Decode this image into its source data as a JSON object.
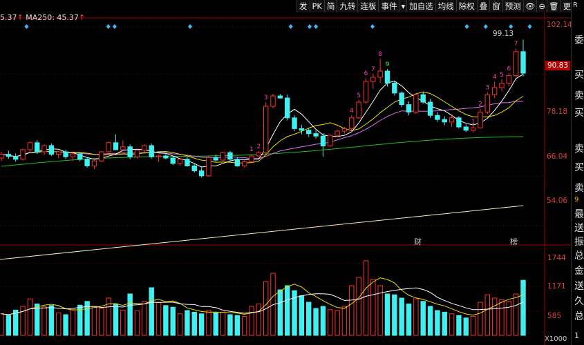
{
  "legend": {
    "ma_prefix": "5.37",
    "ma250_label": "MA250: 45.37",
    "arrow": "↑"
  },
  "toolbar": [
    {
      "label": "发",
      "name": "tool-fa"
    },
    {
      "label": "PK",
      "name": "tool-pk"
    },
    {
      "label": "简",
      "name": "tool-jian"
    },
    {
      "label": "九转",
      "name": "tool-jiuzhuan"
    },
    {
      "label": "连板",
      "name": "tool-lianban"
    },
    {
      "label": "事件",
      "name": "tool-shijian"
    },
    {
      "label": "▾",
      "name": "tool-dropdown-icon"
    },
    {
      "label": "加自选",
      "name": "tool-add-watchlist"
    },
    {
      "label": "均线",
      "name": "tool-junxian"
    },
    {
      "label": "除权",
      "name": "tool-chuquan"
    },
    {
      "label": "叠",
      "name": "tool-overlay"
    },
    {
      "label": "窗",
      "name": "tool-window"
    },
    {
      "label": "预测",
      "name": "tool-forecast"
    },
    {
      "label": "👁",
      "name": "tool-eye-icon"
    },
    {
      "label": "⊖",
      "name": "tool-zoom-out-icon"
    },
    {
      "label": "🗑",
      "name": "tool-trash-icon"
    },
    {
      "label": "更多",
      "name": "tool-more"
    },
    {
      "label": "⊕",
      "name": "tool-zoom-in-icon"
    },
    {
      "label": "▸",
      "name": "tool-next-icon"
    }
  ],
  "price_axis": [
    "102.14",
    "90.83",
    "78.18",
    "66.04",
    "54.06"
  ],
  "current_price": "90.83",
  "volume_axis": [
    "1744",
    "1171",
    "585"
  ],
  "volume_unit": "X1000",
  "high_label": "99.13",
  "events": {
    "cai": "财",
    "bang": "榜"
  },
  "right_panel": {
    "top": "R",
    "chars": [
      "委",
      "买",
      "卖",
      "买",
      "卖",
      "买",
      "卖"
    ],
    "mid": "9",
    "notes": [
      "最",
      "送",
      "振",
      "总",
      "金",
      "送",
      "久",
      "总"
    ],
    "bottom": "1"
  },
  "colors": {
    "up": "#ff3030",
    "down": "#40f0f0",
    "ma5": "#ffffff",
    "ma10": "#f0e000",
    "ma20": "#e070f0",
    "ma60": "#20c020",
    "ma250": "#f0f0c0",
    "nine_up": "#ff40c0",
    "nine_down": "#40ff40",
    "grid": "#a00000"
  },
  "chart_data": {
    "type": "candlestick",
    "ylim": [
      50,
      104
    ],
    "vol_ylim": [
      0,
      2000
    ],
    "candles": [
      [
        70.5,
        72.0,
        69.8,
        71.4,
        520
      ],
      [
        71.4,
        72.3,
        70.3,
        70.9,
        480
      ],
      [
        70.9,
        71.6,
        69.6,
        70.2,
        610
      ],
      [
        70.2,
        72.8,
        69.9,
        72.5,
        700
      ],
      [
        72.5,
        74.5,
        72.0,
        74.2,
        880
      ],
      [
        74.2,
        74.8,
        71.5,
        72.0,
        760
      ],
      [
        72.0,
        73.8,
        71.2,
        73.5,
        690
      ],
      [
        73.5,
        74.0,
        71.0,
        71.4,
        720
      ],
      [
        71.4,
        72.2,
        70.4,
        72.0,
        540
      ],
      [
        72.0,
        72.5,
        70.2,
        70.8,
        500
      ],
      [
        70.8,
        71.8,
        69.8,
        71.5,
        620
      ],
      [
        71.5,
        71.9,
        69.7,
        70.2,
        730
      ],
      [
        70.2,
        70.6,
        68.2,
        68.6,
        820
      ],
      [
        68.6,
        70.0,
        67.8,
        69.8,
        700
      ],
      [
        69.8,
        72.2,
        69.5,
        72.0,
        650
      ],
      [
        72.0,
        74.5,
        71.8,
        74.2,
        900
      ],
      [
        74.2,
        76.2,
        73.8,
        72.5,
        760
      ],
      [
        72.5,
        74.8,
        72.2,
        73.2,
        610
      ],
      [
        73.2,
        73.8,
        70.2,
        70.8,
        1000
      ],
      [
        70.8,
        72.6,
        70.4,
        72.4,
        590
      ],
      [
        72.4,
        73.8,
        71.9,
        73.5,
        820
      ],
      [
        73.5,
        74.0,
        70.4,
        70.8,
        1150
      ],
      [
        70.8,
        71.3,
        69.6,
        71.0,
        790
      ],
      [
        71.0,
        71.8,
        70.2,
        70.5,
        720
      ],
      [
        70.5,
        70.9,
        68.8,
        69.2,
        680
      ],
      [
        69.2,
        70.5,
        68.6,
        70.2,
        520
      ],
      [
        70.2,
        70.8,
        68.4,
        68.6,
        600
      ],
      [
        68.6,
        69.2,
        67.0,
        67.4,
        560
      ],
      [
        67.4,
        68.5,
        65.8,
        66.2,
        520
      ],
      [
        66.2,
        71.0,
        66.0,
        70.6,
        600
      ],
      [
        70.6,
        71.4,
        69.6,
        70.0,
        540
      ],
      [
        70.0,
        72.0,
        69.8,
        71.8,
        560
      ],
      [
        71.8,
        72.2,
        69.6,
        70.2,
        500
      ],
      [
        70.2,
        70.6,
        68.4,
        68.6,
        480
      ],
      [
        68.6,
        69.8,
        68.2,
        69.6,
        460
      ],
      [
        69.6,
        71.5,
        69.4,
        71.0,
        700
      ],
      [
        71.0,
        72.2,
        70.6,
        71.8,
        760
      ],
      [
        71.8,
        84.0,
        71.5,
        83.0,
        1300
      ],
      [
        83.0,
        86.0,
        82.5,
        85.5,
        1500
      ],
      [
        85.5,
        86.0,
        84.8,
        85.0,
        1100
      ],
      [
        85.0,
        85.8,
        79.6,
        80.2,
        1200
      ],
      [
        80.2,
        80.8,
        77.0,
        77.6,
        1080
      ],
      [
        77.6,
        78.5,
        76.2,
        77.2,
        960
      ],
      [
        77.2,
        77.8,
        75.6,
        76.4,
        800
      ],
      [
        76.4,
        77.2,
        75.2,
        75.8,
        650
      ],
      [
        75.8,
        76.5,
        70.8,
        73.4,
        700
      ],
      [
        73.4,
        76.2,
        73.2,
        76.0,
        620
      ],
      [
        76.0,
        77.4,
        75.6,
        77.0,
        600
      ],
      [
        77.0,
        78.0,
        76.4,
        77.6,
        700
      ],
      [
        77.6,
        80.8,
        77.2,
        80.2,
        1200
      ],
      [
        80.2,
        84.5,
        80.0,
        84.0,
        1400
      ],
      [
        84.0,
        89.8,
        83.6,
        89.0,
        1800
      ],
      [
        89.0,
        90.8,
        87.2,
        90.0,
        1350
      ],
      [
        90.0,
        94.5,
        88.6,
        91.5,
        1200
      ],
      [
        91.5,
        92.0,
        87.8,
        88.6,
        1000
      ],
      [
        88.6,
        89.2,
        85.6,
        86.2,
        980
      ],
      [
        86.2,
        86.6,
        82.8,
        83.4,
        900
      ],
      [
        83.4,
        84.2,
        80.8,
        81.6,
        760
      ],
      [
        81.6,
        86.2,
        81.2,
        85.8,
        880
      ],
      [
        85.8,
        86.6,
        83.6,
        84.0,
        820
      ],
      [
        84.0,
        84.8,
        80.2,
        80.8,
        700
      ],
      [
        80.8,
        81.6,
        79.2,
        79.8,
        600
      ],
      [
        79.8,
        80.6,
        78.4,
        79.2,
        560
      ],
      [
        79.2,
        80.8,
        78.0,
        80.2,
        520
      ],
      [
        80.2,
        80.6,
        77.6,
        78.0,
        480
      ],
      [
        78.0,
        78.6,
        76.8,
        77.2,
        420
      ],
      [
        77.2,
        78.2,
        76.6,
        77.8,
        460
      ],
      [
        77.8,
        82.4,
        77.6,
        81.6,
        800
      ],
      [
        81.6,
        86.4,
        81.2,
        85.8,
        980
      ],
      [
        85.8,
        89.0,
        85.0,
        87.5,
        900
      ],
      [
        87.5,
        89.5,
        86.6,
        88.6,
        860
      ],
      [
        88.6,
        91.0,
        87.8,
        90.4,
        820
      ],
      [
        90.4,
        97.0,
        90.0,
        96.2,
        1000
      ],
      [
        96.2,
        99.13,
        90.2,
        91.0,
        1330
      ]
    ],
    "ma250_range": [
      46,
      59
    ],
    "nine_turn_marks": [
      {
        "i": 35,
        "n": "1"
      },
      {
        "i": 36,
        "n": "2"
      },
      {
        "i": 37,
        "n": "3"
      },
      {
        "i": 49,
        "n": "4"
      },
      {
        "i": 50,
        "n": "5"
      },
      {
        "i": 51,
        "n": "6"
      },
      {
        "i": 52,
        "n": "7"
      },
      {
        "i": 53,
        "n": "8"
      },
      {
        "i": 54,
        "n": "9"
      },
      {
        "i": 66,
        "n": "1"
      },
      {
        "i": 67,
        "n": "2"
      },
      {
        "i": 68,
        "n": "3"
      },
      {
        "i": 69,
        "n": "4"
      },
      {
        "i": 70,
        "n": "5"
      },
      {
        "i": 71,
        "n": "6"
      },
      {
        "i": 72,
        "n": "7"
      }
    ],
    "diamond_marks": [
      4,
      17,
      18,
      30,
      46,
      49,
      50,
      59,
      74,
      77,
      81,
      84
    ]
  }
}
